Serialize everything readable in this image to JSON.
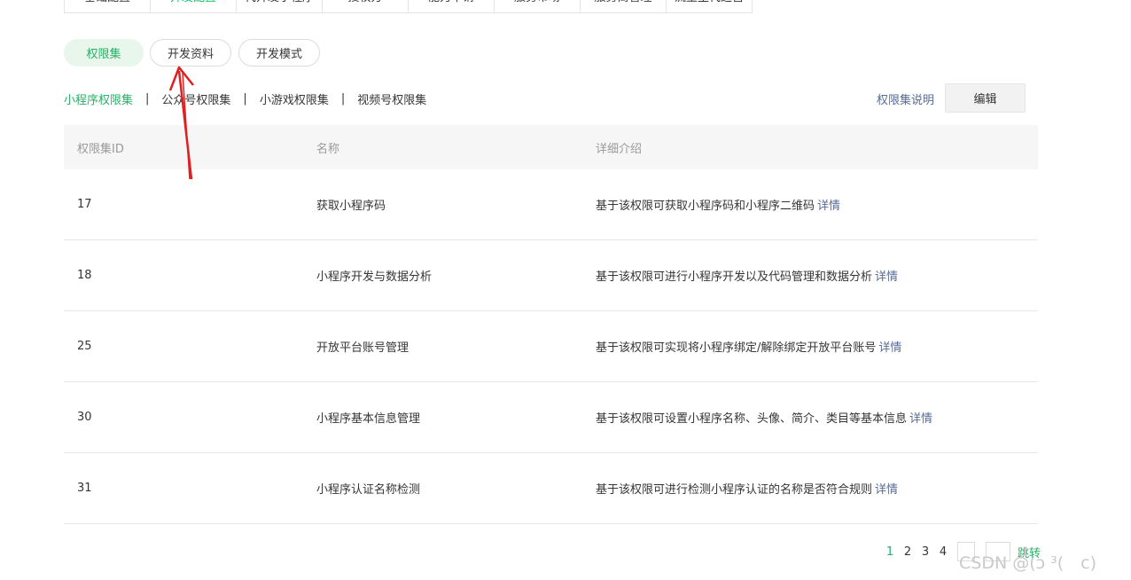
{
  "top_tabs": [
    {
      "label": "基础配置",
      "active": false
    },
    {
      "label": "开发配置",
      "active": true
    },
    {
      "label": "代开发小程序",
      "active": false
    },
    {
      "label": "授权方",
      "active": false
    },
    {
      "label": "能力申请",
      "active": false
    },
    {
      "label": "服务市场",
      "active": false
    },
    {
      "label": "服务商管理",
      "active": false
    },
    {
      "label": "流量主代运营",
      "active": false
    }
  ],
  "pills": [
    {
      "label": "权限集",
      "active": true
    },
    {
      "label": "开发资料",
      "active": false
    },
    {
      "label": "开发模式",
      "active": false
    }
  ],
  "subtabs": [
    {
      "label": "小程序权限集",
      "active": true
    },
    {
      "label": "公众号权限集",
      "active": false
    },
    {
      "label": "小游戏权限集",
      "active": false
    },
    {
      "label": "视频号权限集",
      "active": false
    }
  ],
  "subtab_separator": "|",
  "explain_link": "权限集说明",
  "edit_button": "编辑",
  "table": {
    "headers": [
      "权限集ID",
      "名称",
      "详细介绍"
    ],
    "detail_label": "详情",
    "rows": [
      {
        "id": "17",
        "name": "获取小程序码",
        "desc": "基于该权限可获取小程序码和小程序二维码"
      },
      {
        "id": "18",
        "name": "小程序开发与数据分析",
        "desc": "基于该权限可进行小程序开发以及代码管理和数据分析"
      },
      {
        "id": "25",
        "name": "开放平台账号管理",
        "desc": "基于该权限可实现将小程序绑定/解除绑定开放平台账号"
      },
      {
        "id": "30",
        "name": "小程序基本信息管理",
        "desc": "基于该权限可设置小程序名称、头像、简介、类目等基本信息"
      },
      {
        "id": "31",
        "name": "小程序认证名称检测",
        "desc": "基于该权限可进行检测小程序认证的名称是否符合规则"
      }
    ]
  },
  "pagination": {
    "pages": [
      "1",
      "2",
      "3",
      "4"
    ],
    "current": "1",
    "jump_label": "跳转"
  },
  "watermark": "CSDN @(ↄ ³(　c)",
  "colors": {
    "accent_green": "#2aae67",
    "link_blue": "#576b95",
    "annotation_red": "#e02020"
  }
}
